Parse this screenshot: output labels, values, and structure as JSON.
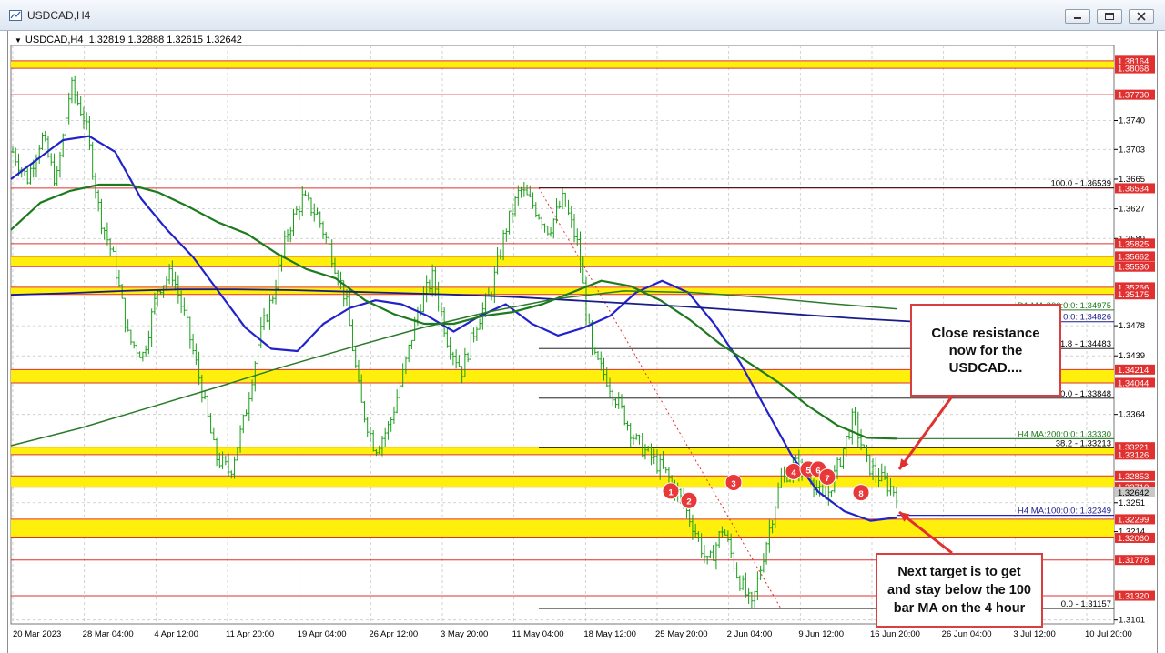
{
  "window": {
    "title": "USDCAD,H4",
    "controls": [
      "minimize",
      "restore",
      "close"
    ]
  },
  "symbol_bar": {
    "symbol": "USDCAD,H4",
    "ohlc": "1.32819 1.32888 1.32615 1.32642"
  },
  "annotations": {
    "resistance_text": "Close resistance\nnow for the\nUSDCAD....",
    "target_text": "Next target is to get\nand stay below the 100\nbar MA on the 4 hour"
  },
  "chart_data": {
    "type": "line",
    "title": "",
    "price_axis_labels": [
      1.374,
      1.3703,
      1.3665,
      1.3627,
      1.3589,
      1.34775,
      1.3439,
      1.3364,
      1.3251,
      1.3214,
      1.3101
    ],
    "current_price": 1.32642,
    "time_axis_labels": [
      "20 Mar 2023",
      "28 Mar 04:00",
      "4 Apr 12:00",
      "11 Apr 20:00",
      "19 Apr 04:00",
      "26 Apr 12:00",
      "3 May 20:00",
      "11 May 04:00",
      "18 May 12:00",
      "25 May 20:00",
      "2 Jun 04:00",
      "9 Jun 12:00",
      "16 Jun 20:00",
      "26 Jun 04:00",
      "3 Jul 12:00",
      "10 Jul 20:00"
    ],
    "horizontal_levels": [
      1.38164,
      1.38068,
      1.3773,
      1.36534,
      1.35825,
      1.35662,
      1.3553,
      1.35266,
      1.35175,
      1.34214,
      1.34044,
      1.33221,
      1.33126,
      1.32853,
      1.3271,
      1.32299,
      1.3206,
      1.31778,
      1.3132
    ],
    "support_resistance_zones": [
      {
        "from": 1.38068,
        "to": 1.38164
      },
      {
        "from": 1.3553,
        "to": 1.35662
      },
      {
        "from": 1.35175,
        "to": 1.35266
      },
      {
        "from": 1.34044,
        "to": 1.34214
      },
      {
        "from": 1.33126,
        "to": 1.33221
      },
      {
        "from": 1.3271,
        "to": 1.32853
      },
      {
        "from": 1.3206,
        "to": 1.32299
      }
    ],
    "fibonacci_levels": [
      {
        "label": "100.0 - 1.36539",
        "value": 1.36539
      },
      {
        "label": "1.8 - 1.34483",
        "value": 1.34483
      },
      {
        "label": "0.0 - 1.33848",
        "value": 1.33848
      },
      {
        "label": "38.2 - 1.33213",
        "value": 1.33213
      },
      {
        "label": "0.0 - 1.31157",
        "value": 1.31157
      }
    ],
    "indicator_labels": [
      {
        "label": "D1 MA:200:0:0: 1.34975",
        "value": 1.34975
      },
      {
        "label": "0:0: 1.34826",
        "value": 1.34826
      },
      {
        "label": "H4 MA:200:0:0: 1.33330",
        "value": 1.3333
      },
      {
        "label": "H4 MA:100:0:0: 1.32349",
        "value": 1.32349
      }
    ],
    "moving_averages": [
      {
        "color": "#2222cc",
        "values": [
          1.3665,
          1.369,
          1.3715,
          1.372,
          1.37,
          1.364,
          1.36,
          1.3565,
          1.352,
          1.3475,
          1.3448,
          1.3445,
          1.348,
          1.35,
          1.351,
          1.3505,
          1.349,
          1.347,
          1.349,
          1.3505,
          1.348,
          1.3465,
          1.3475,
          1.349,
          1.352,
          1.3535,
          1.352,
          1.348,
          1.343,
          1.337,
          1.331,
          1.3265,
          1.324,
          1.3228,
          1.3232
        ]
      },
      {
        "color": "#1e7a1e",
        "values": [
          1.36,
          1.3635,
          1.365,
          1.3658,
          1.3658,
          1.3648,
          1.363,
          1.361,
          1.3595,
          1.357,
          1.355,
          1.3538,
          1.351,
          1.3492,
          1.348,
          1.348,
          1.349,
          1.3495,
          1.3505,
          1.352,
          1.3535,
          1.3528,
          1.351,
          1.3485,
          1.3455,
          1.343,
          1.3405,
          1.3375,
          1.335,
          1.3334,
          1.3333
        ]
      },
      {
        "color": "#1b1b8c",
        "values": [
          1.3517,
          1.3519,
          1.3522,
          1.3524,
          1.3524,
          1.3523,
          1.3521,
          1.3519,
          1.3517,
          1.3514,
          1.351,
          1.3506,
          1.3502,
          1.3497,
          1.3492,
          1.3487,
          1.3483
        ]
      },
      {
        "color": "#2a7a2a",
        "values": [
          1.3324,
          1.3346,
          1.3372,
          1.3398,
          1.3425,
          1.345,
          1.3474,
          1.3495,
          1.3512,
          1.3522,
          1.352,
          1.3514,
          1.3506,
          1.3499
        ]
      }
    ],
    "price_path": [
      1.37,
      1.3665,
      1.372,
      1.366,
      1.3785,
      1.374,
      1.362,
      1.356,
      1.346,
      1.344,
      1.3525,
      1.3545,
      1.348,
      1.34,
      1.331,
      1.329,
      1.336,
      1.346,
      1.352,
      1.36,
      1.364,
      1.362,
      1.357,
      1.351,
      1.338,
      1.332,
      1.335,
      1.342,
      1.35,
      1.354,
      1.346,
      1.342,
      1.348,
      1.352,
      1.36,
      1.3652,
      1.363,
      1.36,
      1.364,
      1.358,
      1.344,
      1.341,
      1.337,
      1.333,
      1.331,
      1.329,
      1.326,
      1.322,
      1.317,
      1.322,
      1.316,
      1.3116,
      1.32,
      1.328,
      1.33,
      1.329,
      1.325,
      1.33,
      1.336,
      1.33,
      1.328,
      1.3264
    ],
    "numbered_markers": [
      "1",
      "2",
      "3",
      "4",
      "5",
      "6",
      "7",
      "8"
    ]
  }
}
